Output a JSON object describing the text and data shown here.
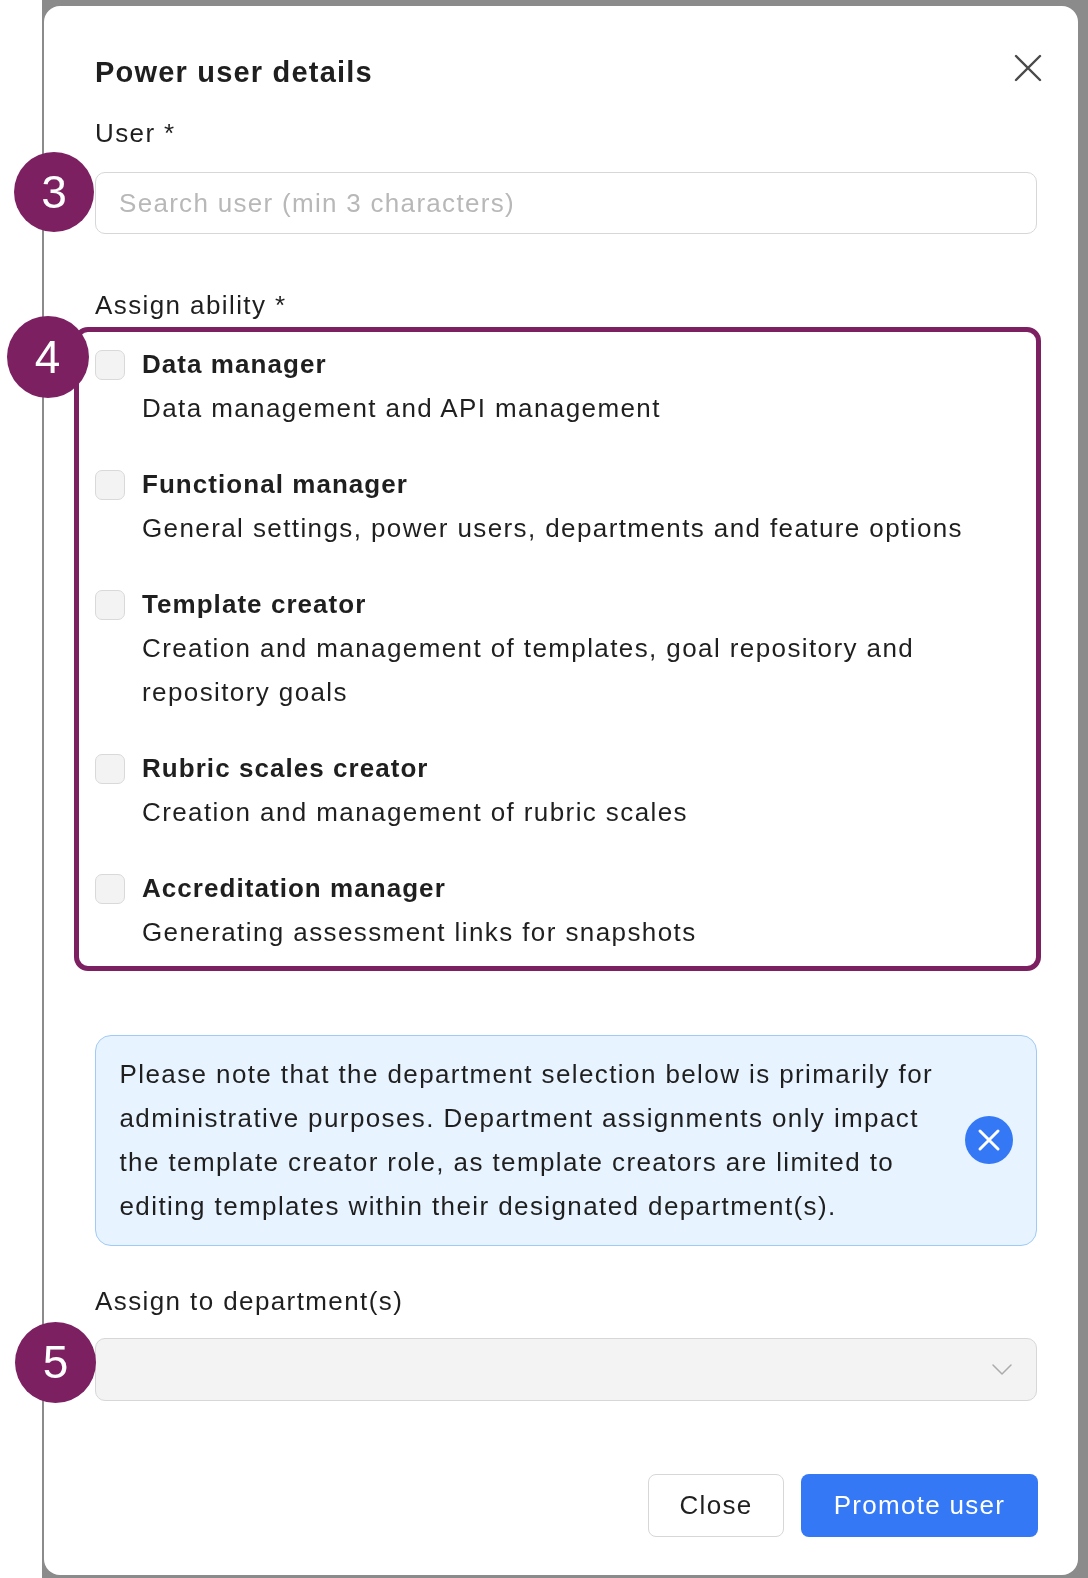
{
  "dialog": {
    "title": "Power user details"
  },
  "user_field": {
    "label": "User *",
    "placeholder": "Search user (min 3 characters)",
    "step": "3"
  },
  "abilities": {
    "label": "Assign ability *",
    "step": "4",
    "highlighted": true,
    "items": [
      {
        "title": "Data manager",
        "description": "Data management and API management",
        "checked": false
      },
      {
        "title": "Functional manager",
        "description": "General settings, power users, departments and feature options",
        "checked": false
      },
      {
        "title": "Template creator",
        "description": "Creation and management of templates, goal repository and repository goals",
        "checked": false
      },
      {
        "title": "Rubric scales creator",
        "description": "Creation and management of rubric scales",
        "checked": false
      },
      {
        "title": "Accreditation manager",
        "description": "Generating assessment links for snapshots",
        "checked": false
      }
    ]
  },
  "notice": {
    "text": "Please note that the department selection below is primarily for administrative purposes. Department assignments only impact the template creator role, as template creators are limited to editing templates within their designated department(s)."
  },
  "department_field": {
    "label": "Assign to department(s)",
    "step": "5",
    "disabled": true
  },
  "buttons": [
    {
      "label": "Close",
      "kind": "secondary"
    },
    {
      "label": "Promote user",
      "kind": "primary"
    }
  ]
}
